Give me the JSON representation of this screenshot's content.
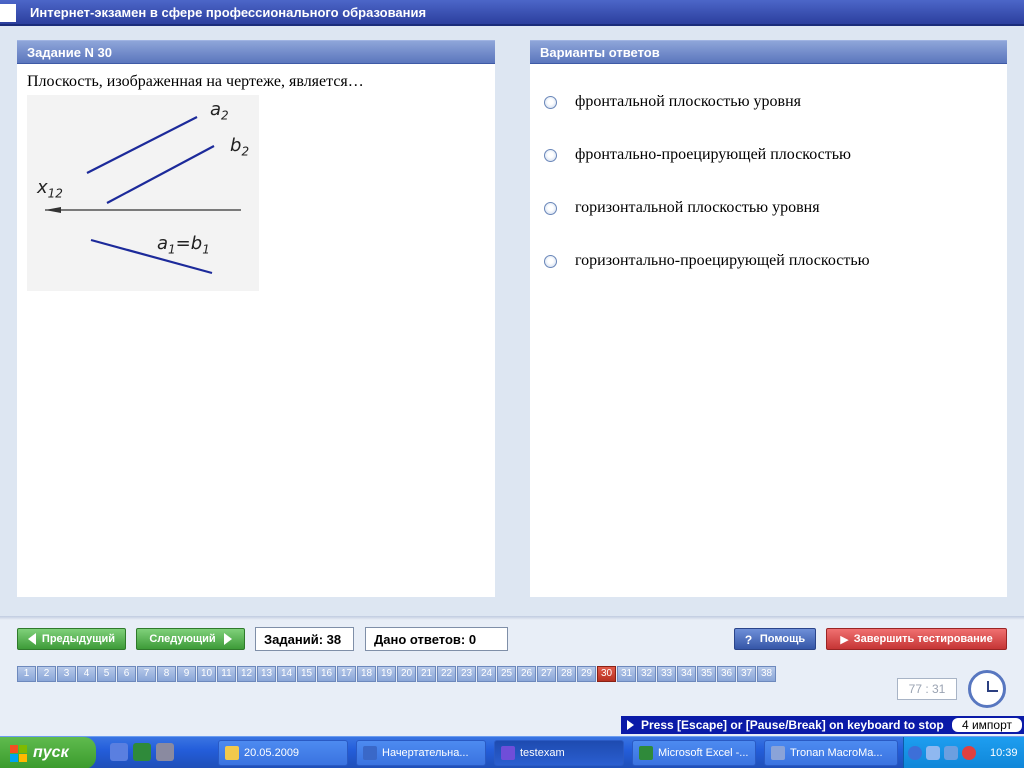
{
  "app": {
    "title": "Интернет-экзамен в сфере профессионального образования"
  },
  "question": {
    "header": "Задание N 30",
    "text": "Плоскость, изображенная на чертеже, является…",
    "figure_labels": {
      "a2": "a",
      "a2_sub": "2",
      "b2": "b",
      "b2_sub": "2",
      "x12": "x",
      "x12_sub": "12",
      "a1b1_a": "a",
      "a1b1_a_sub": "1",
      "a1b1_eq": "=b",
      "a1b1_b_sub": "1"
    }
  },
  "answers": {
    "header": "Варианты ответов",
    "options": [
      "фронтальной плоскостью уровня",
      "фронтально-проецирующей плоскостью",
      "горизонтальной плоскостью уровня",
      "горизонтально-проецирующей плоскостью"
    ]
  },
  "controls": {
    "prev_label": "Предыдущий",
    "next_label": "Следующий",
    "tasks_count": "Заданий: 38",
    "answers_given": "Дано ответов: 0",
    "help_label": "Помощь",
    "finish_label": "Завершить тестирование",
    "timer": "77 : 31"
  },
  "pages": {
    "numbers": [
      "1",
      "2",
      "3",
      "4",
      "5",
      "6",
      "7",
      "8",
      "9",
      "10",
      "11",
      "12",
      "13",
      "14",
      "15",
      "16",
      "17",
      "18",
      "19",
      "20",
      "21",
      "22",
      "23",
      "24",
      "25",
      "26",
      "27",
      "28",
      "29",
      "30",
      "31",
      "32",
      "33",
      "34",
      "35",
      "36",
      "37",
      "38"
    ],
    "active": "30"
  },
  "escape_strip": {
    "text": "Press [Escape] or [Pause/Break] on keyboard to stop",
    "import_label": "4 импорт"
  },
  "taskbar": {
    "start_label": "пуск",
    "tasks": [
      {
        "label": "20.05.2009",
        "icon_color": "#f2c94c"
      },
      {
        "label": "Начертательна...",
        "icon_color": "#3a68c8"
      },
      {
        "label": "testexam",
        "icon_color": "#6f4ed8"
      },
      {
        "label": "Microsoft Excel -...",
        "icon_color": "#2f8a3a"
      },
      {
        "label": "Tronan MacroMa...",
        "icon_color": "#8aa3d8"
      }
    ],
    "clock": "10:39"
  },
  "colors": {
    "header_blue": "#5b76bd",
    "active_page": "#c8402e",
    "finish_red": "#c53535",
    "next_green": "#3d9b38"
  }
}
